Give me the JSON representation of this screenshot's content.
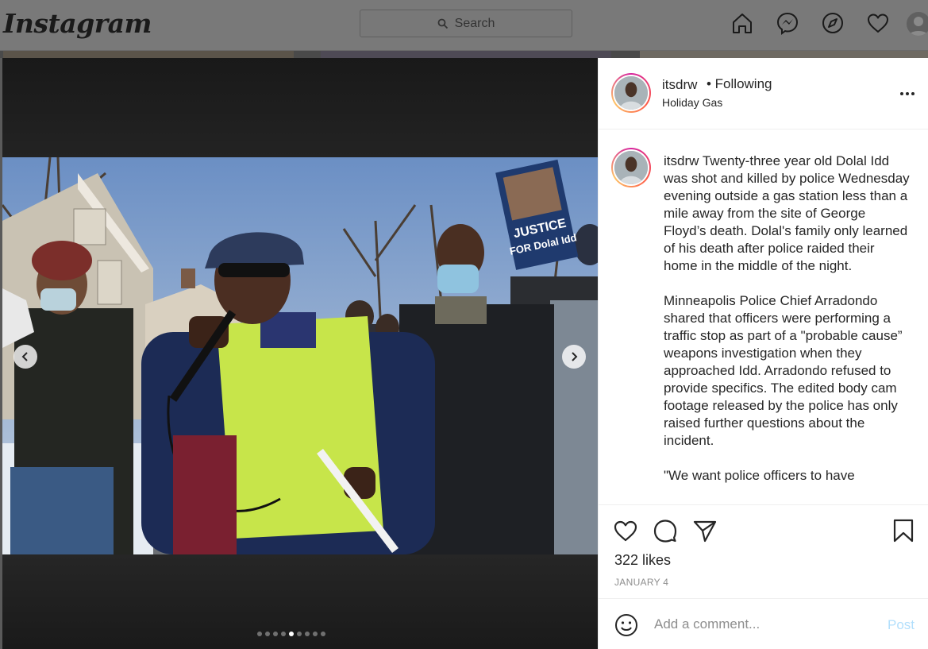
{
  "header": {
    "logo_text": "Instagram",
    "search_placeholder": "Search",
    "nav_icons": [
      "home-icon",
      "messenger-icon",
      "explore-icon",
      "heart-icon",
      "profile-avatar"
    ]
  },
  "post": {
    "author": {
      "username": "itsdrw",
      "follow_status": "• Following",
      "location": "Holiday Gas"
    },
    "photo_sign_text": "JUSTICE FOR Dolal Idd",
    "carousel": {
      "total_slides": 9,
      "active_index": 4
    },
    "caption": {
      "username": "itsdrw",
      "paragraph1": "Twenty-three year old Dolal Idd was shot and killed by police Wednesday evening outside a gas station less than a mile away from the site of George Floyd’s death. Dolal's family only learned of his death after police raided their home in the middle of the night.",
      "paragraph2": "Minneapolis Police Chief Arradondo shared that officers were performing a traffic stop as part of a \"probable cause” weapons investigation when they approached Idd.  Arradondo refused to provide specifics. The edited body cam footage released by the police has only raised further questions about the incident.",
      "paragraph3": "\"We want police officers to have"
    },
    "likes": "322 likes",
    "date": "JANUARY 4",
    "comment": {
      "placeholder": "Add a comment...",
      "post_label": "Post"
    }
  },
  "colors": {
    "overlay_bg": "#5a5a5a",
    "post_button_disabled": "#b2dffc",
    "text": "#262626",
    "muted": "#8e8e8e"
  }
}
